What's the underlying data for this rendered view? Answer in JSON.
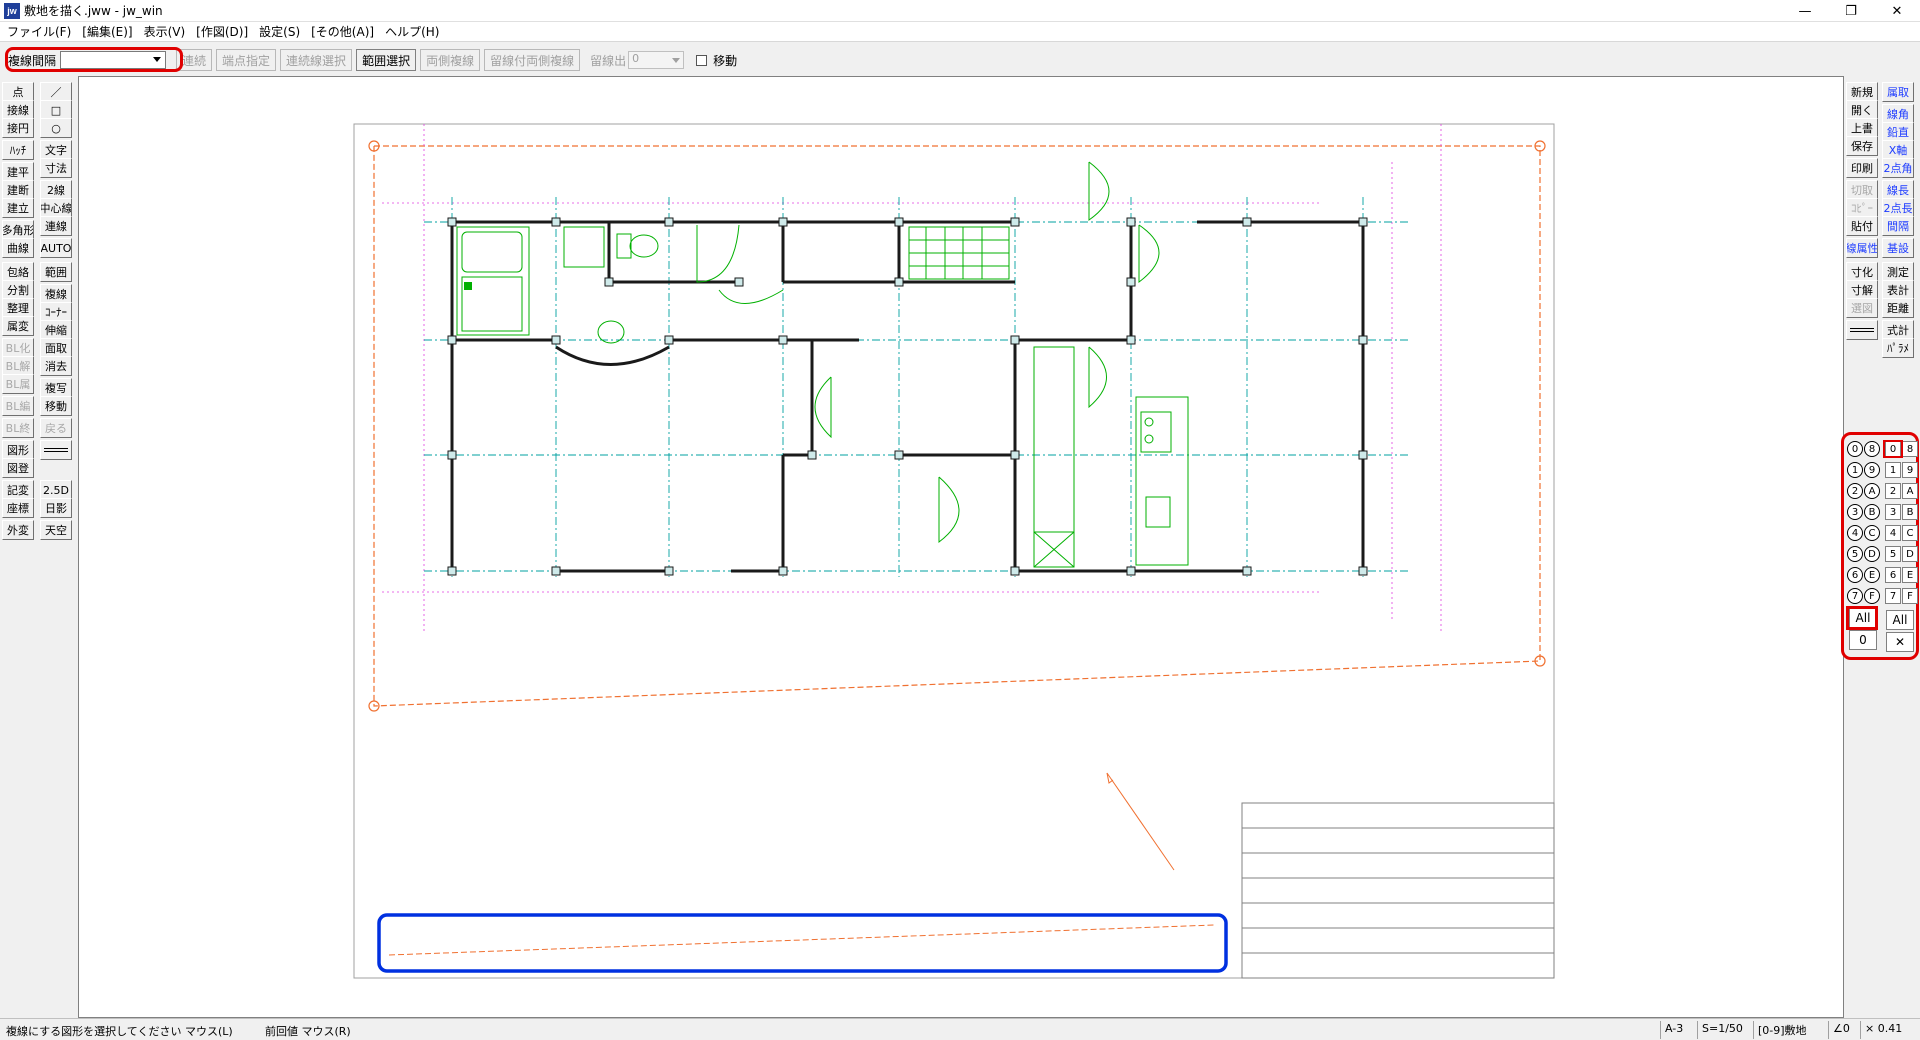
{
  "window": {
    "title": "敷地を描く.jww - jw_win",
    "icon_text": "jw",
    "minimize": "—",
    "restore": "❐",
    "close": "✕"
  },
  "menu": [
    "ファイル(F)",
    "[編集(E)]",
    "表示(V)",
    "[作図(D)]",
    "設定(S)",
    "[その他(A)]",
    "ヘルプ(H)"
  ],
  "options": {
    "mode_label": "複線間隔",
    "mode_value": "",
    "buttons": [
      {
        "label": "連続",
        "enabled": false
      },
      {
        "label": "端点指定",
        "enabled": false
      },
      {
        "label": "連続線選択",
        "enabled": false
      },
      {
        "label": "範囲選択",
        "enabled": true
      },
      {
        "label": "両側複線",
        "enabled": false
      },
      {
        "label": "留線付両側複線",
        "enabled": false
      }
    ],
    "dist_label": "留線出",
    "dist_value": "0",
    "move_label": "移動"
  },
  "left_toolbar": {
    "col1": [
      {
        "label": "点",
        "state": "normal"
      },
      {
        "label": "接線",
        "state": "normal"
      },
      {
        "label": "接円",
        "state": "normal"
      },
      {
        "label": "ﾊｯﾁ",
        "state": "normal"
      },
      {
        "label": "建平",
        "state": "normal"
      },
      {
        "label": "建断",
        "state": "normal"
      },
      {
        "label": "建立",
        "state": "normal"
      },
      {
        "label": "多角形",
        "state": "normal"
      },
      {
        "label": "曲線",
        "state": "normal"
      },
      {
        "label": "包絡",
        "state": "normal"
      },
      {
        "label": "分割",
        "state": "normal"
      },
      {
        "label": "整理",
        "state": "normal"
      },
      {
        "label": "属変",
        "state": "normal"
      },
      {
        "label": "BL化",
        "state": "disabled"
      },
      {
        "label": "BL解",
        "state": "disabled"
      },
      {
        "label": "BL属",
        "state": "disabled"
      },
      {
        "label": "BL編",
        "state": "disabled"
      },
      {
        "label": "BL終",
        "state": "disabled"
      },
      {
        "label": "図形",
        "state": "normal"
      },
      {
        "label": "図登",
        "state": "normal"
      },
      {
        "label": "記変",
        "state": "normal"
      },
      {
        "label": "座標",
        "state": "normal"
      },
      {
        "label": "外変",
        "state": "normal"
      }
    ],
    "col2": [
      {
        "label": "／",
        "state": "normal"
      },
      {
        "label": "□",
        "state": "normal"
      },
      {
        "label": "○",
        "state": "normal"
      },
      {
        "label": "文字",
        "state": "normal"
      },
      {
        "label": "寸法",
        "state": "normal"
      },
      {
        "label": "2線",
        "state": "normal"
      },
      {
        "label": "中心線",
        "state": "normal"
      },
      {
        "label": "連線",
        "state": "normal"
      },
      {
        "label": "AUTO",
        "state": "normal"
      },
      {
        "label": "範囲",
        "state": "normal"
      },
      {
        "label": "複線",
        "state": "normal"
      },
      {
        "label": "ｺｰﾅｰ",
        "state": "normal"
      },
      {
        "label": "伸縮",
        "state": "normal"
      },
      {
        "label": "面取",
        "state": "normal"
      },
      {
        "label": "消去",
        "state": "normal"
      },
      {
        "label": "複写",
        "state": "normal"
      },
      {
        "label": "移動",
        "state": "normal"
      },
      {
        "label": "戻る",
        "state": "disabled"
      },
      {
        "label": "",
        "state": "normal"
      },
      {
        "label": "2.5D",
        "state": "normal"
      },
      {
        "label": "日影",
        "state": "normal"
      },
      {
        "label": "天空",
        "state": "normal"
      }
    ]
  },
  "right_toolbar": {
    "col1": [
      {
        "label": "新規",
        "state": "normal"
      },
      {
        "label": "開く",
        "state": "normal"
      },
      {
        "label": "上書",
        "state": "normal"
      },
      {
        "label": "保存",
        "state": "normal"
      },
      {
        "label": "印刷",
        "state": "normal"
      },
      {
        "label": "切取",
        "state": "disabled"
      },
      {
        "label": "ｺﾋﾟｰ",
        "state": "disabled"
      },
      {
        "label": "貼付",
        "state": "normal"
      },
      {
        "label": "線属性",
        "state": "blue"
      },
      {
        "label": "寸化",
        "state": "normal"
      },
      {
        "label": "寸解",
        "state": "normal"
      },
      {
        "label": "選図",
        "state": "disabled"
      },
      {
        "label": "",
        "state": "normal"
      }
    ],
    "col2": [
      {
        "label": "属取",
        "state": "blue"
      },
      {
        "label": "線角",
        "state": "blue"
      },
      {
        "label": "鉛直",
        "state": "blue"
      },
      {
        "label": "X軸",
        "state": "blue"
      },
      {
        "label": "2点角",
        "state": "blue"
      },
      {
        "label": "線長",
        "state": "blue"
      },
      {
        "label": "2点長",
        "state": "blue"
      },
      {
        "label": "間隔",
        "state": "blue"
      },
      {
        "label": "基設",
        "state": "blue"
      },
      {
        "label": "測定",
        "state": "normal"
      },
      {
        "label": "表計",
        "state": "normal"
      },
      {
        "label": "距離",
        "state": "normal"
      },
      {
        "label": "式計",
        "state": "normal"
      },
      {
        "label": "ﾊﾟﾗﾒ",
        "state": "normal"
      }
    ]
  },
  "layers": {
    "group_circles_left": [
      "0",
      "1",
      "2",
      "3",
      "4",
      "5",
      "6",
      "7"
    ],
    "group_circles_right": [
      "8",
      "9",
      "A",
      "B",
      "C",
      "D",
      "E",
      "F"
    ],
    "layer_left": [
      "0",
      "1",
      "2",
      "3",
      "4",
      "5",
      "6",
      "7"
    ],
    "layer_right": [
      "8",
      "9",
      "A",
      "B",
      "C",
      "D",
      "E",
      "F"
    ],
    "all_group": "All",
    "all_layer": "All",
    "group_zero": "0",
    "close_glyph": "✕"
  },
  "status": {
    "message": "複線にする図形を選択してください マウス(L)",
    "prev": "前回値 マウス(R)",
    "paper": "A-3",
    "scale": "S=1/50",
    "layer": "[0-9]敷地",
    "angle": "∠0",
    "zoom": "× 0.41"
  },
  "colors": {
    "accent_red": "#e00000",
    "highlight_blue": "#0030e0",
    "wall": "#1a1a1a",
    "fixture": "#00c000",
    "grid": "#00a0a0",
    "site_line": "#f07030",
    "aux": "#e040e0"
  }
}
